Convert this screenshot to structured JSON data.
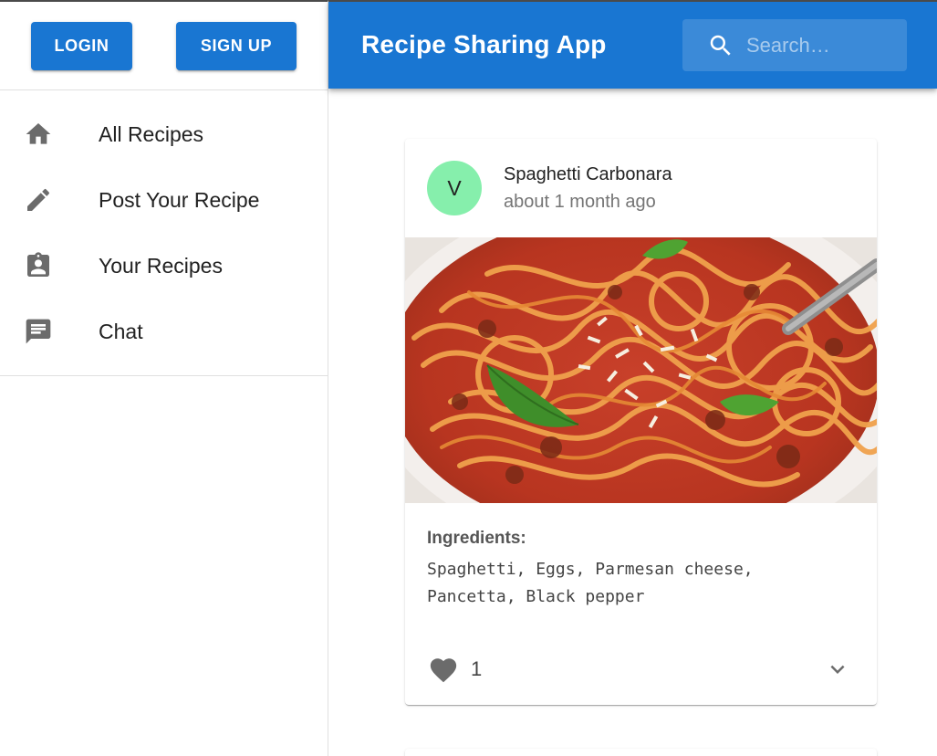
{
  "auth": {
    "login_label": "LOGIN",
    "signup_label": "SIGN UP"
  },
  "sidebar": {
    "items": [
      {
        "label": "All Recipes",
        "icon": "home-icon"
      },
      {
        "label": "Post Your Recipe",
        "icon": "pencil-icon"
      },
      {
        "label": "Your Recipes",
        "icon": "clipboard-user-icon"
      },
      {
        "label": "Chat",
        "icon": "chat-icon"
      }
    ]
  },
  "header": {
    "title": "Recipe Sharing App",
    "search": {
      "placeholder": "Search…",
      "icon": "search-icon"
    }
  },
  "colors": {
    "primary": "#1976d2",
    "avatar": "#86efac",
    "text": "#222222",
    "muted": "#757575",
    "icon": "#6b6b6b"
  },
  "card": {
    "avatar_letter": "V",
    "title": "Spaghetti Carbonara",
    "subtitle": "about 1 month ago",
    "image_alt": "Spaghetti Carbonara",
    "ingredients_label": "Ingredients:",
    "ingredients": "Spaghetti, Eggs, Parmesan cheese, Pancetta, Black pepper",
    "likes": "1",
    "like_icon": "heart-icon",
    "expand_icon": "chevron-down-icon"
  }
}
